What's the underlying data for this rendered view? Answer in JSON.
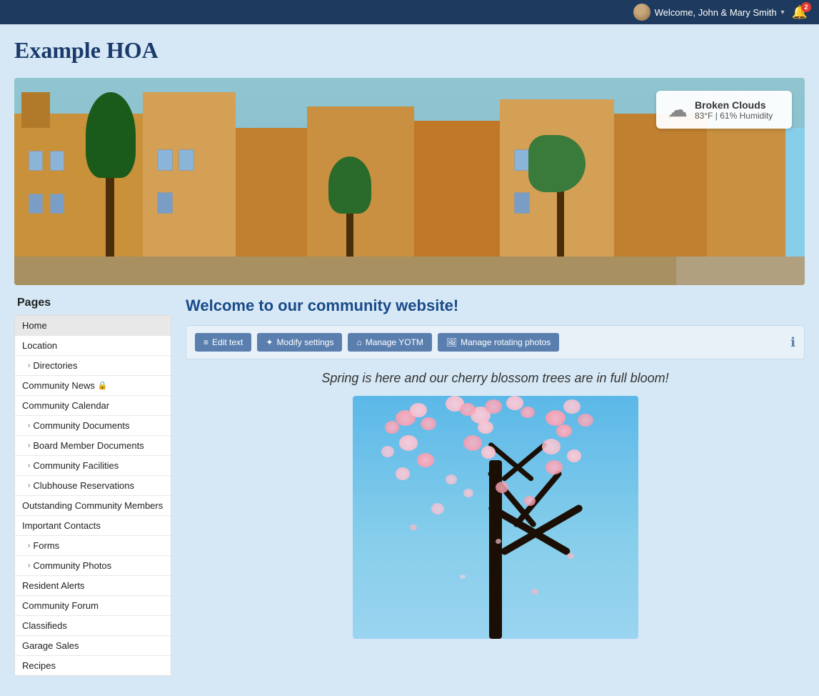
{
  "topbar": {
    "welcome_text": "Welcome, John & Mary Smith",
    "chevron": "▾",
    "notification_count": "2"
  },
  "site": {
    "title": "Example HOA"
  },
  "weather": {
    "condition": "Broken Clouds",
    "details": "83°F  |  61% Humidity"
  },
  "sidebar": {
    "pages_label": "Pages",
    "items": [
      {
        "label": "Home",
        "active": true,
        "sub": false,
        "expandable": false
      },
      {
        "label": "Location",
        "active": false,
        "sub": false,
        "expandable": false
      },
      {
        "label": "Directories",
        "active": false,
        "sub": true,
        "expandable": true
      },
      {
        "label": "Community News",
        "active": false,
        "sub": false,
        "expandable": false,
        "locked": true
      },
      {
        "label": "Community Calendar",
        "active": false,
        "sub": false,
        "expandable": false
      },
      {
        "label": "Community Documents",
        "active": false,
        "sub": true,
        "expandable": true
      },
      {
        "label": "Board Member Documents",
        "active": false,
        "sub": true,
        "expandable": true
      },
      {
        "label": "Community Facilities",
        "active": false,
        "sub": true,
        "expandable": true
      },
      {
        "label": "Clubhouse Reservations",
        "active": false,
        "sub": true,
        "expandable": true
      },
      {
        "label": "Outstanding Community Members",
        "active": false,
        "sub": false,
        "expandable": false
      },
      {
        "label": "Important Contacts",
        "active": false,
        "sub": false,
        "expandable": false
      },
      {
        "label": "Forms",
        "active": false,
        "sub": true,
        "expandable": true
      },
      {
        "label": "Community Photos",
        "active": false,
        "sub": true,
        "expandable": true
      },
      {
        "label": "Resident Alerts",
        "active": false,
        "sub": false,
        "expandable": false
      },
      {
        "label": "Community Forum",
        "active": false,
        "sub": false,
        "expandable": false
      },
      {
        "label": "Classifieds",
        "active": false,
        "sub": false,
        "expandable": false
      },
      {
        "label": "Garage Sales",
        "active": false,
        "sub": false,
        "expandable": false
      },
      {
        "label": "Recipes",
        "active": false,
        "sub": false,
        "expandable": false
      }
    ]
  },
  "content": {
    "page_heading": "Welcome to our community website!",
    "toolbar": {
      "edit_text": "Edit text",
      "modify_settings": "Modify settings",
      "manage_yotm": "Manage YOTM",
      "manage_photos": "Manage rotating photos"
    },
    "welcome_message": "Spring is here and our cherry blossom trees are in full bloom!"
  },
  "icons": {
    "edit": "≡",
    "settings": "✦",
    "house": "⌂",
    "image": "🖼",
    "info": "ℹ",
    "bell": "🔔",
    "cloud": "☁",
    "chevron_right": "›",
    "lock": "🔒"
  }
}
